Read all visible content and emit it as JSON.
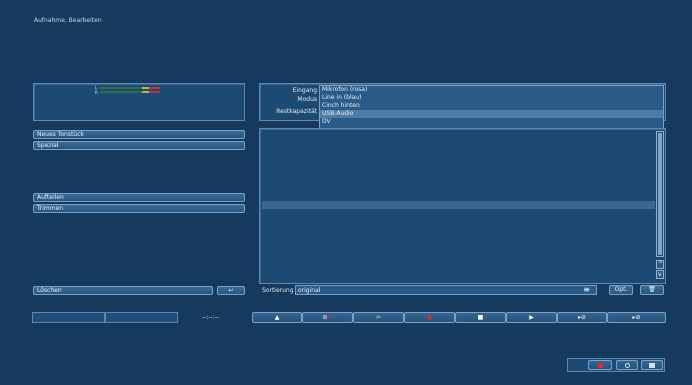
{
  "title": "Aufnahme, Bearbeiten",
  "meter": {
    "left_label": "L",
    "right_label": "R"
  },
  "left_buttons": {
    "neues_tonstueck": "Neues Tonstück",
    "spezial": "Spezial",
    "aufteilen": "Aufteilen",
    "trimmen": "Trimmen",
    "loeschen": "Löschen",
    "undo_icon": "↩"
  },
  "settings": {
    "eingang_label": "Eingang",
    "modus_label": "Modus",
    "restkapazitaet_label": "Restkapazität",
    "options": [
      "Mikrofon (rosa)",
      "Line in (blau)",
      "Cinch hinten",
      "USB-Audio",
      "DV"
    ],
    "selected_index": 3
  },
  "sort": {
    "label": "Sortierung",
    "value": "original",
    "menu_icon": "≡",
    "opt_label": "Opt.",
    "trash_icon": "🗑"
  },
  "transport": {
    "time": "--:--:--",
    "eject": "▲",
    "stop_r": "⊘",
    "cut": "✂",
    "record": "●",
    "stop": "■",
    "play": "▶",
    "fwd_stop": "▸⊘",
    "fwd_stop2": "▸⊘"
  },
  "colors": {
    "record": "#d0303a",
    "bg": "#153a5e"
  }
}
